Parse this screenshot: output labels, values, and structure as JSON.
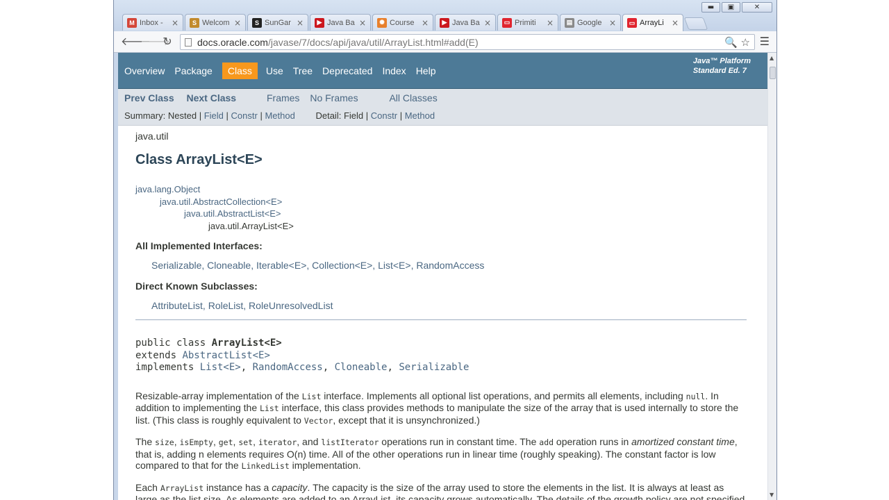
{
  "browser": {
    "tabs": [
      {
        "label": "Inbox -",
        "icon": "gmail-icon",
        "color": "#d44638",
        "glyph": "M"
      },
      {
        "label": "Welcom",
        "icon": "sungard-icon",
        "color": "#c28a2c",
        "glyph": "S"
      },
      {
        "label": "SunGar",
        "icon": "s-logo-icon",
        "color": "#222222",
        "glyph": "S"
      },
      {
        "label": "Java Ba",
        "icon": "youtube-icon",
        "color": "#cc181e",
        "glyph": "▶"
      },
      {
        "label": "Course",
        "icon": "course-icon",
        "color": "#e8802c",
        "glyph": "✺"
      },
      {
        "label": "Java Ba",
        "icon": "youtube-icon",
        "color": "#cc181e",
        "glyph": "▶"
      },
      {
        "label": "Primiti",
        "icon": "oracle-icon",
        "color": "#e0252f",
        "glyph": "▭"
      },
      {
        "label": "Google",
        "icon": "google-docs-icon",
        "color": "#8a8a8a",
        "glyph": "▤"
      },
      {
        "label": "ArrayLi",
        "icon": "oracle-icon",
        "color": "#e0252f",
        "glyph": "▭"
      }
    ],
    "url_host": "docs.oracle.com",
    "url_path": "/javase/7/docs/api/java/util/ArrayList.html#add(E)",
    "window_controls": {
      "minimize": "▬",
      "maximize": "▣",
      "close": "✕"
    }
  },
  "javadoc": {
    "nav": [
      "Overview",
      "Package",
      "Class",
      "Use",
      "Tree",
      "Deprecated",
      "Index",
      "Help"
    ],
    "about_line1": "Java™ Platform",
    "about_line2": "Standard Ed. 7",
    "prev_class": "Prev Class",
    "next_class": "Next Class",
    "frames": "Frames",
    "no_frames": "No Frames",
    "all_classes": "All Classes",
    "summary_label": "Summary:",
    "summary_nested": "Nested",
    "summary_field": "Field",
    "summary_constr": "Constr",
    "summary_method": "Method",
    "detail_label": "Detail:",
    "detail_field": "Field",
    "detail_constr": "Constr",
    "detail_method": "Method",
    "sep": "|"
  },
  "content": {
    "package": "java.util",
    "title": "Class ArrayList<E>",
    "inheritance": [
      "java.lang.Object",
      "java.util.AbstractCollection<E>",
      "java.util.AbstractList<E>",
      "java.util.ArrayList<E>"
    ],
    "interfaces_heading": "All Implemented Interfaces:",
    "interfaces": "Serializable, Cloneable, Iterable<E>, Collection<E>, List<E>, RandomAccess",
    "subclasses_heading": "Direct Known Subclasses:",
    "subclasses": "AttributeList, RoleList, RoleUnresolvedList",
    "sig_public": "public class ",
    "sig_name": "ArrayList<E>",
    "sig_extends": "extends ",
    "sig_extends_type": "AbstractList<E>",
    "sig_implements": "implements ",
    "sig_impl_1": "List<E>",
    "sig_impl_2": "RandomAccess",
    "sig_impl_3": "Cloneable",
    "sig_impl_4": "Serializable",
    "sig_comma": ", ",
    "p1_a": "Resizable-array implementation of the ",
    "p1_code1": "List",
    "p1_b": " interface. Implements all optional list operations, and permits all elements, including ",
    "p1_code2": "null",
    "p1_c": ". In addition to implementing the ",
    "p1_code3": "List",
    "p1_d": " interface, this class provides methods to manipulate the size of the array that is used internally to store the list. (This class is roughly equivalent to ",
    "p1_code4": "Vector",
    "p1_e": ", except that it is unsynchronized.)",
    "p2_a": "The ",
    "p2_c1": "size",
    "p2_c2": "isEmpty",
    "p2_c3": "get",
    "p2_c4": "set",
    "p2_c5": "iterator",
    "p2_and": ", and ",
    "p2_c6": "listIterator",
    "p2_b": " operations run in constant time. The ",
    "p2_c7": "add",
    "p2_c": " operation runs in ",
    "p2_em": "amortized constant time",
    "p2_d": ", that is, adding n elements requires O(n) time. All of the other operations run in linear time (roughly speaking). The constant factor is low compared to that for the ",
    "p2_c8": "LinkedList",
    "p2_e": " implementation.",
    "p3_a": "Each ",
    "p3_code": "ArrayList",
    "p3_b": " instance has a ",
    "p3_em": "capacity",
    "p3_c": ". The capacity is the size of the array used to store the elements in the list. It is always at least as large as the list size. As elements are added to an ArrayList, its capacity grows automatically. The details of the growth policy are not specified beyond"
  }
}
